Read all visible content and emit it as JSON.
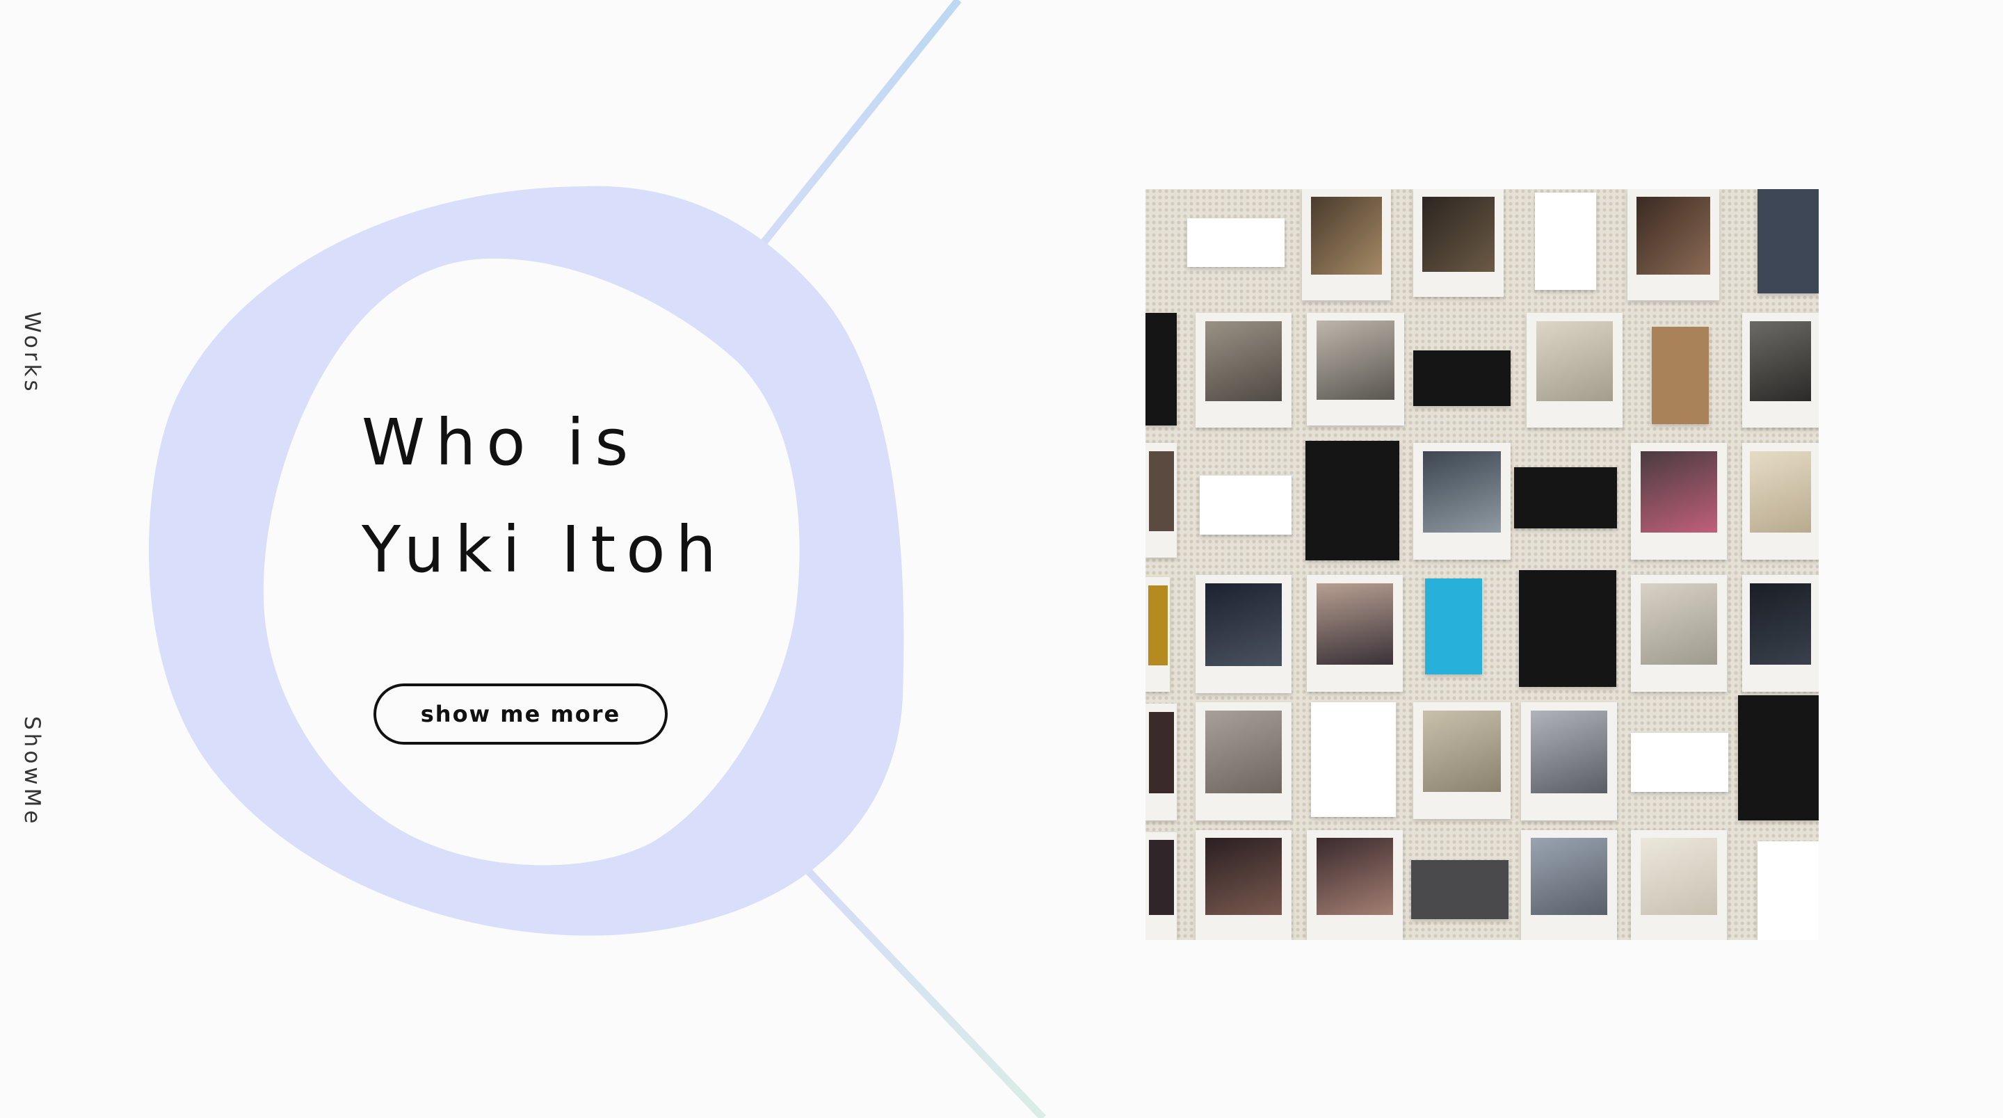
{
  "nav": {
    "works_label": "Works",
    "showme_label": "ShowMe"
  },
  "hero": {
    "title_line1": "Who is",
    "title_line2": "Yuki Itoh",
    "cta_label": "show me more"
  },
  "colors": {
    "blob": "#d9dffa",
    "accent_line_top": "#c7dbf4",
    "accent_line_bottom": "#d3ddf5",
    "text": "#111111",
    "background": "#fbfbfc"
  },
  "photo_wall": {
    "description_icon": "photo-collage"
  }
}
